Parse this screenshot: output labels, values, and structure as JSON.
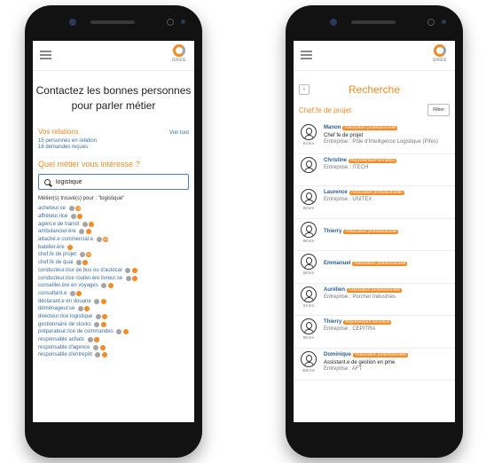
{
  "logo": {
    "text": "GREE"
  },
  "screen1": {
    "headline_line1": "Contactez les bonnes personnes",
    "headline_line2": "pour parler métier",
    "relations": {
      "title": "Vos relations",
      "link": "Voir tout",
      "lines": [
        "15 personnes en relation",
        "16 demandes reçues"
      ]
    },
    "question": "Quel métier vous intéresse ?",
    "search_value": "logistique",
    "results_title": "Métier(s) trouvé(s) pour : \"logistique\"",
    "metiers": [
      {
        "name": "acheteur.se",
        "badges": [
          "grey",
          "orange"
        ],
        "counts": [
          "",
          "12"
        ]
      },
      {
        "name": "affréteur.rice",
        "badges": [
          "grey",
          "orange"
        ],
        "counts": [
          "",
          ""
        ]
      },
      {
        "name": "agent.e de transit",
        "badges": [
          "grey",
          "orange"
        ],
        "counts": [
          "",
          ""
        ]
      },
      {
        "name": "ambulancier.ère",
        "badges": [
          "grey",
          "orange"
        ],
        "counts": [
          "",
          ""
        ]
      },
      {
        "name": "attaché.e commercial.e",
        "badges": [
          "grey",
          "orange"
        ],
        "counts": [
          "",
          "40"
        ]
      },
      {
        "name": "batelier.ère",
        "badges": [
          "orange"
        ],
        "counts": [
          ""
        ]
      },
      {
        "name": "chef.fe de projet",
        "badges": [
          "grey",
          "orange"
        ],
        "counts": [
          "",
          "10"
        ]
      },
      {
        "name": "chef.fe de quai",
        "badges": [
          "grey",
          "orange"
        ],
        "counts": [
          "",
          ""
        ]
      },
      {
        "name": "conducteur.rice de bus ou d'autocar",
        "badges": [
          "grey",
          "orange"
        ],
        "counts": [
          "",
          ""
        ]
      },
      {
        "name": "conducteur.rice routier.ère livreur.se",
        "badges": [
          "grey",
          "orange"
        ],
        "counts": [
          "",
          ""
        ]
      },
      {
        "name": "conseiller.ère en voyages",
        "badges": [
          "grey",
          "orange"
        ],
        "counts": [
          "",
          ""
        ]
      },
      {
        "name": "consultant.e",
        "badges": [
          "grey",
          "orange"
        ],
        "counts": [
          "",
          ""
        ]
      },
      {
        "name": "déclarant.e en douane",
        "badges": [
          "grey",
          "orange"
        ],
        "counts": [
          "",
          ""
        ]
      },
      {
        "name": "déménageur.se",
        "badges": [
          "grey",
          "orange"
        ],
        "counts": [
          "",
          ""
        ]
      },
      {
        "name": "directeur.rice logistique",
        "badges": [
          "grey",
          "orange"
        ],
        "counts": [
          "",
          ""
        ]
      },
      {
        "name": "gestionnaire de stocks",
        "badges": [
          "grey",
          "orange"
        ],
        "counts": [
          "",
          ""
        ]
      },
      {
        "name": "préparateur.rice de commandes",
        "badges": [
          "grey",
          "orange"
        ],
        "counts": [
          "",
          ""
        ]
      },
      {
        "name": "responsable achats",
        "badges": [
          "grey",
          "orange"
        ],
        "counts": [
          "",
          ""
        ]
      },
      {
        "name": "responsable d'agence",
        "badges": [
          "grey",
          "orange"
        ],
        "counts": [
          "",
          ""
        ]
      },
      {
        "name": "responsable d'entrepôt",
        "badges": [
          "grey",
          "orange"
        ],
        "counts": [
          "",
          ""
        ]
      }
    ]
  },
  "screen2": {
    "back_label": "‹",
    "title": "Recherche",
    "role": "Chef.fe de projet",
    "filter_label": "Filtrer",
    "contacts": [
      {
        "name": "Manon",
        "tag": "Association professionnelle",
        "job": "Chef fe de projet",
        "org": "Entreprise : Pôle d'Intelligence Logistique (Pifes)",
        "dist": "64 km"
      },
      {
        "name": "Christine",
        "tag": "Représentant formation",
        "job": "",
        "org": "Entreprise : ITECH",
        "dist": ""
      },
      {
        "name": "Laurence",
        "tag": "Association professionnelle",
        "job": "",
        "org": "Entreprise : UNITEX",
        "dist": "98 km"
      },
      {
        "name": "Thierry",
        "tag": "Association professionnelle",
        "job": "",
        "org": "",
        "dist": "98 km"
      },
      {
        "name": "Emmanuel",
        "tag": "Association professionnelle",
        "job": "",
        "org": "",
        "dist": "98 km"
      },
      {
        "name": "Aurélien",
        "tag": "Association professionnelle",
        "job": "",
        "org": "Entreprise : Porcher Industries",
        "dist": "54 km"
      },
      {
        "name": "Thierry",
        "tag": "Représentant formation",
        "job": "",
        "org": "Entreprise : CEPITRA",
        "dist": "98 km"
      },
      {
        "name": "Dominique",
        "tag": "Association professionnelle",
        "job": "Assistant.e de gestion en pme",
        "org": "Entreprise : AFT",
        "dist": "300 km"
      }
    ]
  },
  "colors": {
    "accent": "#f28c28",
    "link": "#3a6ea5",
    "badge_grey": "#a5a5a5"
  },
  "icons": [
    "menu-icon",
    "logo-icon",
    "search-icon",
    "back-icon",
    "avatar-icon"
  ]
}
